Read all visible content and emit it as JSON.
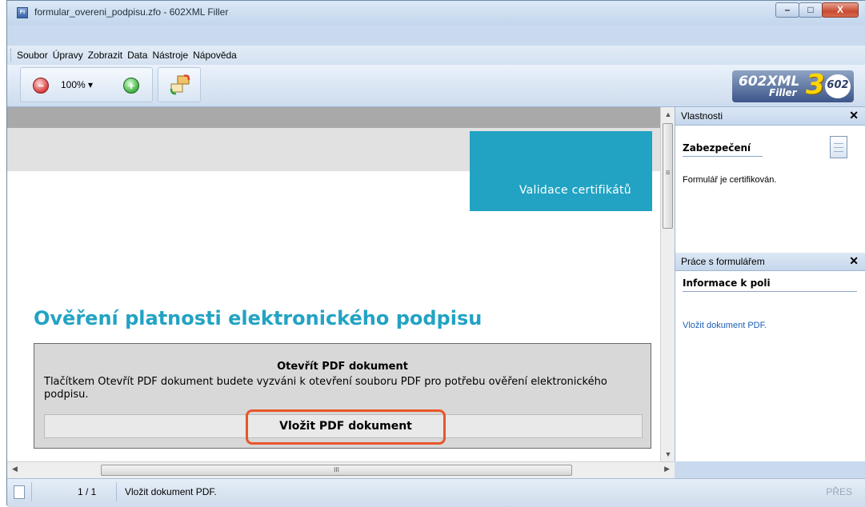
{
  "window": {
    "title": "formular_overeni_podpisu.zfo - 602XML Filler",
    "app_icon": "fi-icon",
    "buttons": {
      "minimize": "–",
      "maximize": "□",
      "close": "X"
    }
  },
  "menu": {
    "items": [
      "Soubor",
      "Úpravy",
      "Zobrazit",
      "Data",
      "Nástroje",
      "Nápověda"
    ]
  },
  "toolbar": {
    "zoom_value": "100%",
    "zoom_dropdown": "▾",
    "zoom_out_icon": "minus-icon",
    "zoom_in_icon": "plus-icon",
    "swap_icon": "refresh-arrows-icon"
  },
  "logo": {
    "brand": "602XML",
    "product": "Filler",
    "version": "3",
    "badge": "602"
  },
  "document": {
    "banner_text": "Validace certifikátů",
    "heading": "Ověření platnosti elektronického podpisu",
    "box_title": "Otevřít PDF dokument",
    "box_text": "Tlačítkem Otevřít PDF dokument budete vyzváni k otevření souboru PDF pro potřebu ověření elektronického podpisu.",
    "insert_button": "Vložit PDF dokument"
  },
  "scrollbars": {
    "up": "▲",
    "down": "▼",
    "left": "◀",
    "right": "▶",
    "grip": "III",
    "vgrip": "≡"
  },
  "panels": {
    "properties": {
      "title": "Vlastnosti",
      "close": "✕",
      "section": "Zabezpečení",
      "text": "Formulář je certifikován."
    },
    "form_work": {
      "title": "Práce s formulářem",
      "close": "✕",
      "section": "Informace k poli",
      "text": "Vložit dokument PDF."
    }
  },
  "status": {
    "page": "1 / 1",
    "message": "Vložit dokument PDF.",
    "mode": "PŘES"
  },
  "colors": {
    "accent": "#22a3c3",
    "highlight": "#e8562a",
    "link": "#1a5fb4"
  }
}
